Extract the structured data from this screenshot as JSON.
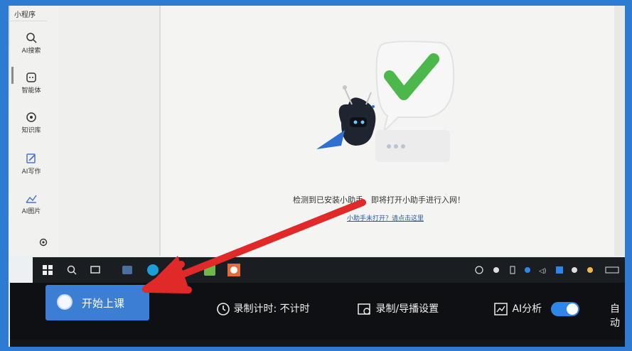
{
  "sidebar": {
    "top_label": "小程序",
    "items": [
      {
        "label": "AI搜索",
        "icon": "search-icon"
      },
      {
        "label": "智能体",
        "icon": "bot-icon"
      },
      {
        "label": "知识库",
        "icon": "knowledge-icon"
      },
      {
        "label": "AI写作",
        "icon": "write-icon"
      },
      {
        "label": "AI图片",
        "icon": "image-icon"
      }
    ]
  },
  "main": {
    "message": "检测到已安装小助手，即将打开小助手进行入网！",
    "link_text": "小助手未打开？请点击这里"
  },
  "control_bar": {
    "start_label": "开始上课",
    "timer_label": "录制计时: 不计时",
    "record_settings_label": "录制/导播设置",
    "ai_analysis_label": "AI分析",
    "ai_analysis_enabled": true,
    "auto_label": "自动"
  },
  "colors": {
    "accent": "#3a7fd4",
    "toggle_on": "#2f86e8",
    "arrow": "#e02a2a",
    "check": "#4cb84b"
  }
}
